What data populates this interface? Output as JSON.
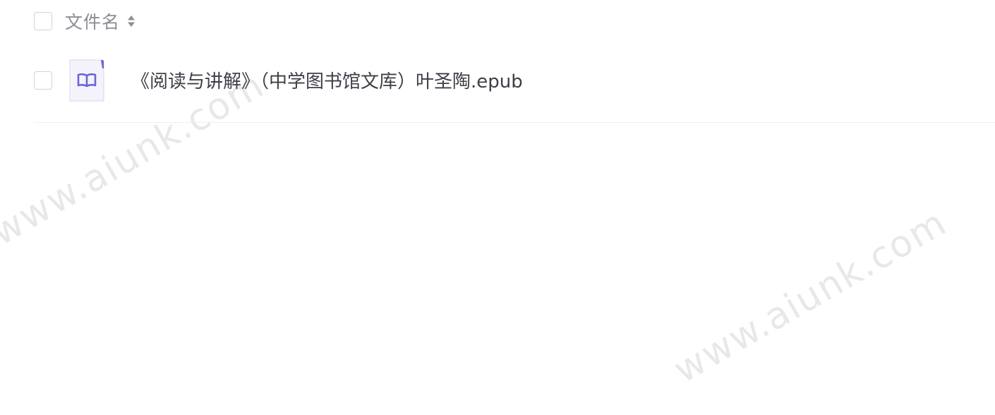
{
  "header": {
    "column_label": "文件名",
    "sort_icon": "sort-icon"
  },
  "files": [
    {
      "name": "《阅读与讲解》（中学图书馆文库）叶圣陶.epub",
      "icon": "book-icon",
      "icon_color": "#6c63d9"
    }
  ],
  "watermarks": [
    "www.aiunk.com",
    "www.aiunk.com"
  ],
  "colors": {
    "checkbox_border": "#cfd3da",
    "header_text": "#8b8e95",
    "file_text": "#3c3f46",
    "file_icon_accent": "#6c63d9",
    "file_icon_bg": "#f4f3fb"
  }
}
